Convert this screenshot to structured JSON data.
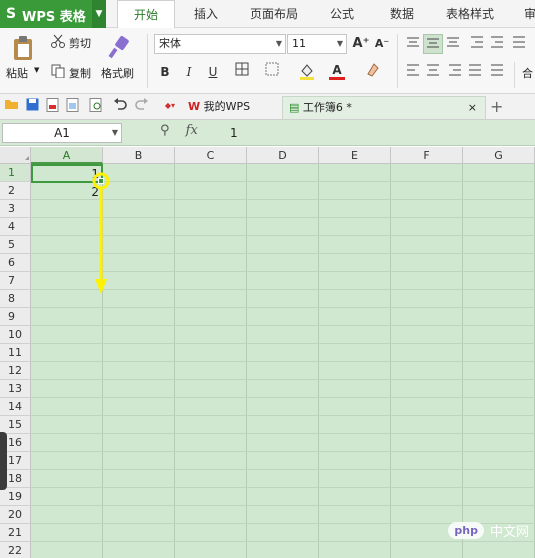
{
  "app": {
    "logo": "S",
    "title": "WPS 表格",
    "menu_arrow": "▼"
  },
  "menu": {
    "tabs": [
      "开始",
      "插入",
      "页面布局",
      "公式",
      "数据",
      "表格样式",
      "审"
    ],
    "active": "开始"
  },
  "ribbon": {
    "paste_label": "粘贴",
    "cut_label": "剪切",
    "copy_label": "复制",
    "format_painter_label": "格式刷",
    "font_name": "宋体",
    "font_size": "11",
    "bold": "B",
    "italic": "I",
    "underline": "U",
    "grow_font": "A⁺",
    "shrink_font": "A⁻",
    "merge_label": "合",
    "colors": {
      "fill_highlight": "#f5e13a",
      "font_color": "#e02020"
    }
  },
  "tabs": {
    "home_tab": "我的WPS",
    "workbook_tab": "工作簿6 *",
    "close": "×",
    "new": "+"
  },
  "formula_bar": {
    "name_box": "A1",
    "zoom_icon": "⚲",
    "fx": "fx",
    "value": "1"
  },
  "sheet": {
    "columns": [
      "A",
      "B",
      "C",
      "D",
      "E",
      "F",
      "G"
    ],
    "rows": [
      "1",
      "2",
      "3",
      "4",
      "5",
      "6",
      "7",
      "8",
      "9",
      "10",
      "11",
      "12",
      "13",
      "14",
      "15",
      "16",
      "17",
      "18",
      "19",
      "20",
      "21",
      "22"
    ],
    "cells": {
      "A1": "1",
      "A2": "2"
    },
    "selected": "A1",
    "drag_arrow_color": "#fff200"
  },
  "watermark": {
    "logo": "php",
    "text": "中文网"
  }
}
